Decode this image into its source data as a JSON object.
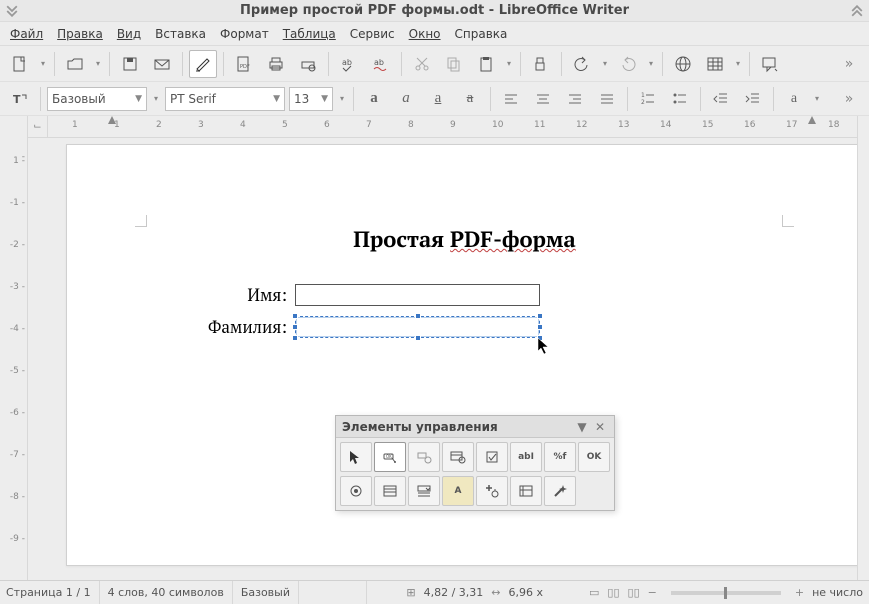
{
  "window": {
    "title": "Пример простой PDF формы.odt - LibreOffice Writer"
  },
  "menu": {
    "file": "Файл",
    "edit": "Правка",
    "view": "Вид",
    "insert": "Вставка",
    "format": "Формат",
    "table": "Таблица",
    "tools": "Сервис",
    "window": "Окно",
    "help": "Справка"
  },
  "format_bar": {
    "para_style": "Базовый",
    "font_name": "PT Serif",
    "font_size": "13"
  },
  "ruler": {
    "h": [
      "1",
      "1",
      "2",
      "3",
      "4",
      "5",
      "6",
      "7",
      "8",
      "9",
      "10",
      "11",
      "12",
      "13",
      "14",
      "15",
      "16",
      "17",
      "18"
    ],
    "v": [
      "1",
      "1",
      "2",
      "3",
      "4",
      "5",
      "6",
      "7",
      "8",
      "9"
    ]
  },
  "document": {
    "title_plain": "Простая ",
    "title_wavy": "PDF-форма",
    "label_name": "Имя:",
    "label_surname": "Фамилия:"
  },
  "form_controls": {
    "title": "Элементы управления",
    "row1": {
      "select": "select-tool",
      "design": "design-mode",
      "control": "control-props",
      "form": "form-props",
      "checkbox": "checkbox",
      "textbox": "abI",
      "formatted": "%f",
      "button": "OK"
    },
    "row2": {
      "radio": "radio",
      "listbox": "listbox",
      "combo": "combo",
      "label": "A",
      "more": "more-controls",
      "nav": "form-nav",
      "wizard": "wizard"
    }
  },
  "status": {
    "page": "Страница 1 / 1",
    "words": "4 слов, 40 символов",
    "style": "Базовый",
    "coords": "4,82 / 3,31",
    "size": "6,96 x",
    "overwrite": "не число"
  }
}
